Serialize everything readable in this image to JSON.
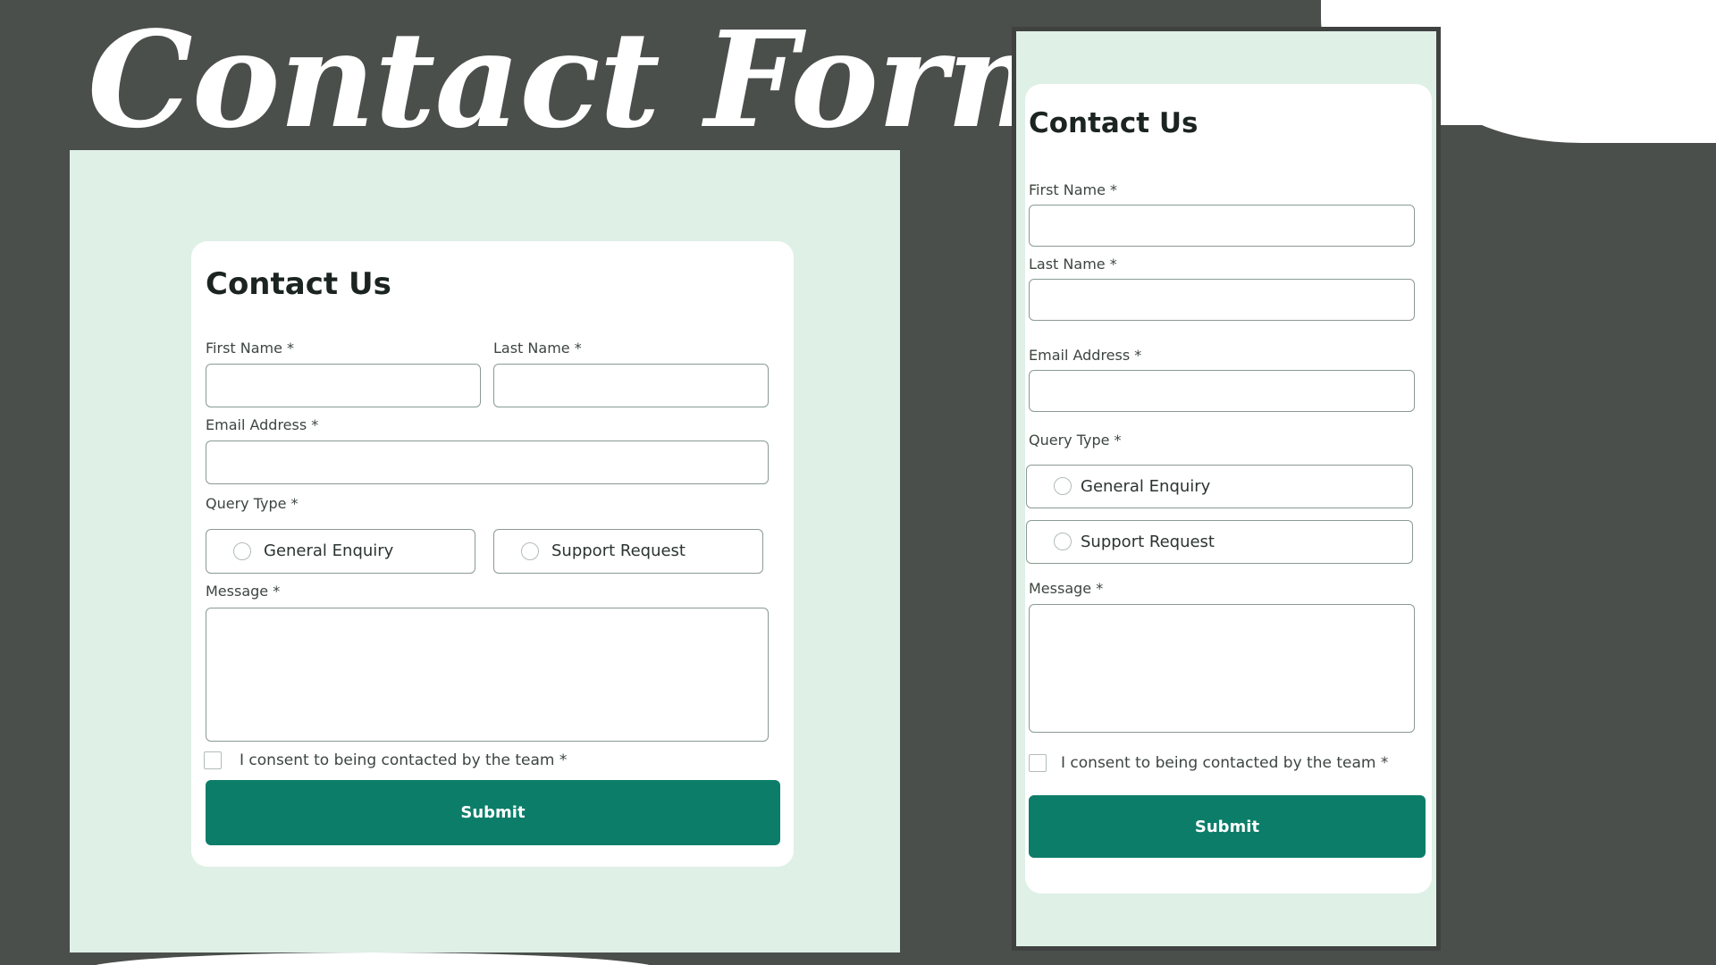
{
  "slide": {
    "title": "Contact Form"
  },
  "form": {
    "heading": "Contact Us",
    "first_name_label": "First Name *",
    "last_name_label": "Last Name *",
    "email_label": "Email Address *",
    "query_type_label": "Query Type *",
    "query_options": [
      "General Enquiry",
      "Support Request"
    ],
    "message_label": "Message *",
    "consent_label": "I consent to being contacted by the team *",
    "submit_label": "Submit"
  },
  "colors": {
    "background": "#4b4f4c",
    "panel": "#dff0e6",
    "accent": "#0c7d69",
    "card": "#ffffff"
  }
}
